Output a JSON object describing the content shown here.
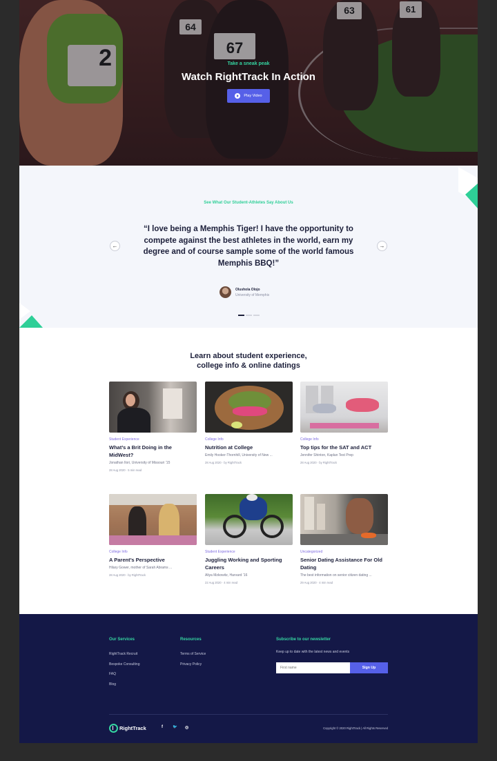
{
  "hero": {
    "tag": "Take a sneak peak",
    "title": "Watch RightTrack In Action",
    "play_label": "Play Video",
    "bibs": [
      "64",
      "67",
      "2",
      "63",
      "61"
    ]
  },
  "testimonial": {
    "tag": "See What Our Student-Athletes Say About Us",
    "quote": "“I love being a Memphis Tiger! I have the opportunity to compete against the best athletes in the world, earn my degree and of course sample some of the world famous Memphis BBQ!”",
    "author_name": "Olushola Olojo",
    "author_school": "University of Memphis",
    "prev_icon": "arrow-left-icon",
    "next_icon": "arrow-right-icon",
    "slide_count": 3,
    "active_slide": 1
  },
  "articles": {
    "title_line1": "Learn about student experience,",
    "title_line2": "college info & online datings",
    "items": [
      {
        "category": "Student Experience",
        "title": "What’s a Brit Doing in the MidWest?",
        "author": "Jonathan Ilori, University of Missouri ’15",
        "date": "28 Aug 2020",
        "extra": "5 min read"
      },
      {
        "category": "College Info",
        "title": "Nutrition at College",
        "author": "Emily Hooker-Thornhill, University of New ...",
        "date": "28 Aug 2020",
        "extra": "by RightTrack"
      },
      {
        "category": "College Info",
        "title": "Top tips for the SAT and ACT",
        "author": "Jennifer Shinton, Kaplan Test Prep",
        "date": "28 Aug 2020",
        "extra": "by RightTrack"
      },
      {
        "category": "College Info",
        "title": "A Parent’s Perspective",
        "author": "Hilary Gower, mother of Sarah Abrams ...",
        "date": "28 Aug 2020",
        "extra": "by RightTrack"
      },
      {
        "category": "Student Experience",
        "title": "Juggling Working and Sporting Careers",
        "author": "Aliya Mzkowitz, Harvard ’16",
        "date": "22 Aug 2020",
        "extra": "4 min read"
      },
      {
        "category": "Uncategorized",
        "title": "Senior Dating Assistance For Old Dating",
        "author": "The best information on senior citizen dating ...",
        "date": "29 Aug 2020",
        "extra": "4 min read"
      }
    ]
  },
  "footer": {
    "services_heading": "Our Services",
    "services": [
      "RightTrack Recruit",
      "Bespoke Consulting",
      "FAQ",
      "Blog"
    ],
    "resources_heading": "Resources",
    "resources": [
      "Terms of Service",
      "Privacy Policy"
    ],
    "newsletter_heading": "Subscribe to our newsletter",
    "newsletter_text": "Keep up to date with the latest news and events",
    "newsletter_placeholder": "First name",
    "signup_label": "Sign Up",
    "logo_text": "RightTrack",
    "social": [
      {
        "icon": "facebook-icon",
        "glyph": "f"
      },
      {
        "icon": "twitter-icon",
        "glyph": "🐦"
      },
      {
        "icon": "instagram-icon",
        "glyph": "◎"
      }
    ],
    "copyright": "Copyright © 2020 RightTrack | All Rights Reserved"
  },
  "colors": {
    "accent": "#5660e8",
    "green": "#35d6a2",
    "navy": "#141847",
    "category": "#7e6be0"
  }
}
